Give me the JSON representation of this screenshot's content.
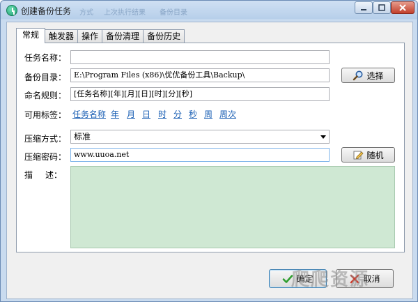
{
  "window": {
    "title": "创建备份任务",
    "ghost_title_parts": [
      "方式",
      "上次执行结果",
      "备份目录"
    ]
  },
  "tabs": [
    {
      "label": "常规",
      "active": true
    },
    {
      "label": "触发器",
      "active": false
    },
    {
      "label": "操作",
      "active": false
    },
    {
      "label": "备份清理",
      "active": false
    },
    {
      "label": "备份历史",
      "active": false
    }
  ],
  "form": {
    "task_name_label": "任务名称：",
    "task_name_value": "",
    "backup_dir_label": "备份目录：",
    "backup_dir_value": "E:\\Program Files (x86)\\优优备份工具\\Backup\\",
    "choose_button": "选择",
    "naming_rule_label": "命名规则：",
    "naming_rule_value": "[任务名称][年][月][日][时][分][秒]",
    "tags_label": "可用标签：",
    "tags": [
      "任务名称",
      "年",
      "月",
      "日",
      "时",
      "分",
      "秒",
      "周",
      "周次"
    ],
    "compression_label": "压缩方式：",
    "compression_value": "标准",
    "password_label": "压缩密码：",
    "password_value": "www.uuoa.net",
    "random_button": "随机",
    "description_label_1": "描",
    "description_label_2": "述：",
    "description_value": ""
  },
  "footer": {
    "ok_button": "确定",
    "cancel_button": "取消"
  },
  "watermark_text": "爬爬资源",
  "colors": {
    "link": "#1a5fb4",
    "description_bg": "#cfe8d3",
    "title_gradient_top": "#cfe0f3",
    "close_button": "#c2402c"
  },
  "icons": {
    "app": "backup-app-icon",
    "choose": "magnifier-icon",
    "random": "pencil-icon",
    "ok": "checkmark-icon",
    "cancel": "cross-icon"
  }
}
